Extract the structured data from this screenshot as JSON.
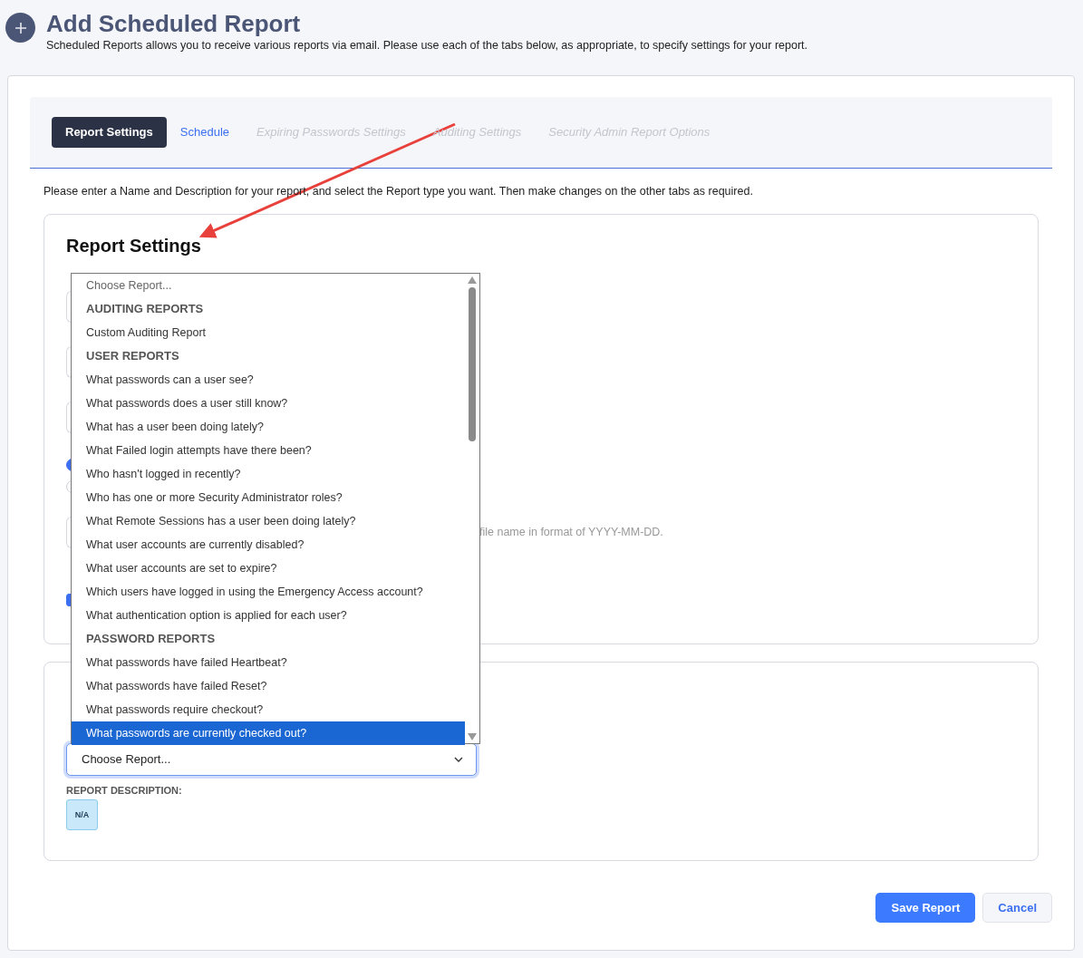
{
  "header": {
    "title": "Add Scheduled Report",
    "subtitle": "Scheduled Reports allows you to receive various reports via email. Please use each of the tabs below, as appropriate, to specify settings for your report."
  },
  "tabs": [
    {
      "label": "Report Settings",
      "selected": true,
      "disabled": false
    },
    {
      "label": "Schedule",
      "selected": false,
      "disabled": false
    },
    {
      "label": "Expiring Passwords Settings",
      "selected": false,
      "disabled": true
    },
    {
      "label": "Auditing Settings",
      "selected": false,
      "disabled": true
    },
    {
      "label": "Security Admin Report Options",
      "selected": false,
      "disabled": true
    }
  ],
  "instructions": "Please enter a Name and Description for your report, and select the Report type you want. Then make changes on the other tabs as required.",
  "settings_card": {
    "title": "Report Settings",
    "fields": [
      {
        "kind": "input"
      },
      {
        "kind": "input"
      },
      {
        "kind": "input"
      },
      {
        "kind": "radio",
        "checked": true
      },
      {
        "kind": "radio",
        "checked": false
      },
      {
        "kind": "input",
        "hint": "file name in format of YYYY-MM-DD."
      },
      {
        "kind": "checkbox",
        "checked": true
      }
    ]
  },
  "dropdown": {
    "options": [
      {
        "kind": "placeholder",
        "label": "Choose Report...",
        "selected": false
      },
      {
        "kind": "group",
        "label": "AUDITING REPORTS",
        "selected": false
      },
      {
        "kind": "option",
        "label": "Custom Auditing Report",
        "selected": false
      },
      {
        "kind": "group",
        "label": "USER REPORTS",
        "selected": false
      },
      {
        "kind": "option",
        "label": "What passwords can a user see?",
        "selected": false
      },
      {
        "kind": "option",
        "label": "What passwords does a user still know?",
        "selected": false
      },
      {
        "kind": "option",
        "label": "What has a user been doing lately?",
        "selected": false
      },
      {
        "kind": "option",
        "label": "What Failed login attempts have there been?",
        "selected": false
      },
      {
        "kind": "option",
        "label": "Who hasn't logged in recently?",
        "selected": false
      },
      {
        "kind": "option",
        "label": "Who has one or more Security Administrator roles?",
        "selected": false
      },
      {
        "kind": "option",
        "label": "What Remote Sessions has a user been doing lately?",
        "selected": false
      },
      {
        "kind": "option",
        "label": "What user accounts are currently disabled?",
        "selected": false
      },
      {
        "kind": "option",
        "label": "What user accounts are set to expire?",
        "selected": false
      },
      {
        "kind": "option",
        "label": "Which users have logged in using the Emergency Access account?",
        "selected": false
      },
      {
        "kind": "option",
        "label": "What authentication option is applied for each user?",
        "selected": false
      },
      {
        "kind": "group",
        "label": "PASSWORD REPORTS",
        "selected": false
      },
      {
        "kind": "option",
        "label": "What passwords have failed Heartbeat?",
        "selected": false
      },
      {
        "kind": "option",
        "label": "What passwords have failed Reset?",
        "selected": false
      },
      {
        "kind": "option",
        "label": "What passwords require checkout?",
        "selected": false
      },
      {
        "kind": "option",
        "label": "What passwords are currently checked out?",
        "selected": true
      }
    ]
  },
  "report_card": {
    "select": {
      "value": "Choose Report...",
      "focused": true
    },
    "description_label": "REPORT DESCRIPTION:",
    "description": "N/A"
  },
  "buttons": [
    {
      "label": "Save Report",
      "kind": "primary"
    },
    {
      "label": "Cancel",
      "kind": "secondary"
    }
  ]
}
